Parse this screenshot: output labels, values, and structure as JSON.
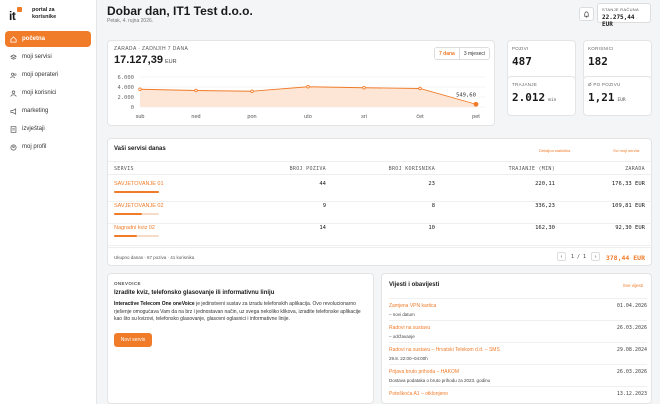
{
  "brand": {
    "logo_text": "it",
    "line1": "portal za",
    "line2": "korisnike"
  },
  "nav": [
    {
      "label": "početna",
      "icon": "home-icon",
      "active": true
    },
    {
      "label": "moji servisi",
      "icon": "layers-icon"
    },
    {
      "label": "moji operateri",
      "icon": "users-icon"
    },
    {
      "label": "moji korisnici",
      "icon": "user-icon"
    },
    {
      "label": "marketing",
      "icon": "megaphone-icon"
    },
    {
      "label": "izvještaji",
      "icon": "report-icon"
    },
    {
      "label": "moj profil",
      "icon": "profile-icon"
    }
  ],
  "header": {
    "greeting": "Dobar dan, IT1 Test d.o.o.",
    "date": "Petak, 4. rujna 2026.",
    "balance_label": "STANJE RAČUNA",
    "balance_value": "22.275,44 EUR"
  },
  "chart_card": {
    "label": "ZARADA · ZADNJIH 7 DANA",
    "total": "17.127,39",
    "currency": "EUR",
    "range_options": [
      "7 dana",
      "3 mjeseci"
    ],
    "range_selected": "7 dana"
  },
  "chart_data": {
    "type": "area",
    "categories": [
      "sub",
      "ned",
      "pon",
      "uto",
      "sri",
      "čet",
      "pet"
    ],
    "values": [
      3550,
      3300,
      3150,
      4050,
      3850,
      3700,
      549.6
    ],
    "y_ticks": [
      "6.000",
      "4.000",
      "2.000",
      "0"
    ],
    "ylim": [
      0,
      6000
    ],
    "annotation": "549,60",
    "color": "#f07c2a"
  },
  "stats": [
    {
      "label": "POZIVI",
      "value": "487",
      "unit": ""
    },
    {
      "label": "KORISNICI",
      "value": "182",
      "unit": ""
    },
    {
      "label": "TRAJANJE",
      "value": "2.012",
      "unit": "min"
    },
    {
      "label": "Ø PO POZIVU",
      "value": "1,21",
      "unit": "EUR"
    }
  ],
  "services": {
    "title": "Vaši servisi danas",
    "link_stats": "Detaljna statistika",
    "link_all": "Svi moji servisi",
    "columns": [
      "SERVIS",
      "BROJ POZIVA",
      "BROJ KORISNIKA",
      "TRAJANJE (MIN)",
      "ZARADA"
    ],
    "rows": [
      {
        "name": "SAVJETOVANJE 01",
        "calls": "44",
        "users": "23",
        "duration": "220,11",
        "earnings": "176,33 EUR",
        "share": 1.0
      },
      {
        "name": "SAVJETOVANJE 02",
        "calls": "9",
        "users": "8",
        "duration": "336,23",
        "earnings": "109,81 EUR",
        "share": 0.62
      },
      {
        "name": "Nagradni kviz 02",
        "calls": "14",
        "users": "10",
        "duration": "162,30",
        "earnings": "92,30 EUR",
        "share": 0.52
      }
    ],
    "summary": "Ukupno danas · 67 poziva · 41 korisnika",
    "page": "1 / 1",
    "total": "378,44 EUR"
  },
  "onevoice": {
    "label": "ONEVOICE",
    "title": "Izradite kviz, telefonsko glasovanje ili informativnu liniju",
    "body_bold": "Interactive Telecom One oneVoice",
    "body_rest": " je jedinstveni sustav za izradu telefonskih aplikacija. Ovo revolucionarno rješenje omogućava Vam da na brz i jednostavan način, uz svega nekoliko klikova, izradite telefonske aplikacije kao što su kvizovi, telefonsko glasovanje, glasovni oglasnici i informativne linije.",
    "button": "Novi servis"
  },
  "news": {
    "title": "Vijesti i obavijesti",
    "link_all": "Sve vijesti",
    "items": [
      {
        "title": "Zamjena VPN kartica",
        "date": "01.04.2026",
        "sub": "– novi datum"
      },
      {
        "title": "Radovi na sustavu",
        "date": "26.03.2026",
        "sub": "– održavanje"
      },
      {
        "title": "Radovi na sustavu – Hrvatski Telekom d.d. – SMS",
        "date": "29.08.2024",
        "sub": "29.8. 22:00–04:00h"
      },
      {
        "title": "Prijava bruto prihoda – HAKOM",
        "date": "26.03.2026",
        "sub": "Dostava podataka o bruto prihodu za 2023. godinu"
      },
      {
        "title": "Poteškoća A1 – otklonjeno",
        "date": "13.12.2023",
        "sub": ""
      }
    ]
  }
}
